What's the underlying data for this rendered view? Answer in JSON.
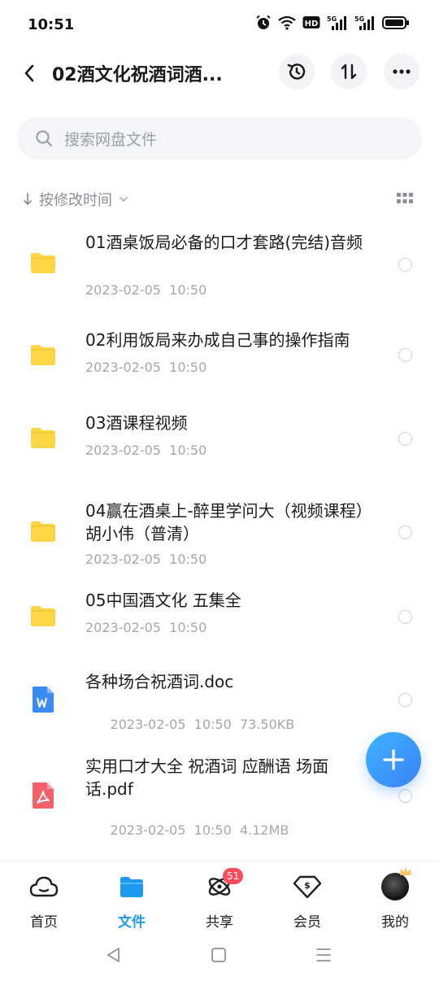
{
  "status_bar": {
    "time": "10:51",
    "signal_label_1": "5G",
    "signal_label_2": "5G",
    "hd_label": "HD"
  },
  "header": {
    "title": "02酒文化祝酒词酒..."
  },
  "search": {
    "placeholder": "搜索网盘文件"
  },
  "sort": {
    "label": "按修改时间"
  },
  "files": [
    {
      "name": "01酒桌饭局必备的口才套路(完结)音频",
      "date": "2023-02-05  10:50",
      "size": "",
      "type": "folder"
    },
    {
      "name": "02利用饭局来办成自己事的操作指南",
      "date": "2023-02-05  10:50",
      "size": "",
      "type": "folder"
    },
    {
      "name": "03酒课程视频",
      "date": "2023-02-05  10:50",
      "size": "",
      "type": "folder"
    },
    {
      "name": "04赢在酒桌上-醉里学问大（视频课程）胡小伟（普清）",
      "date": "2023-02-05  10:50",
      "size": "",
      "type": "folder"
    },
    {
      "name": "05中国酒文化 五集全",
      "date": "2023-02-05  10:50",
      "size": "",
      "type": "folder"
    },
    {
      "name": "各种场合祝酒词.doc",
      "date": "2023-02-05  10:50",
      "size": "73.50KB",
      "type": "doc"
    },
    {
      "name": "实用口才大全 祝酒词 应酬语 场面话.pdf",
      "date": "2023-02-05  10:50",
      "size": "4.12MB",
      "type": "pdf"
    }
  ],
  "nav": {
    "home": "首页",
    "files": "文件",
    "share": "共享",
    "share_badge": "51",
    "vip": "会员",
    "me": "我的"
  },
  "colors": {
    "accent": "#1d9bf0",
    "folder": "#fcd647",
    "badge": "#ff4d5a"
  }
}
